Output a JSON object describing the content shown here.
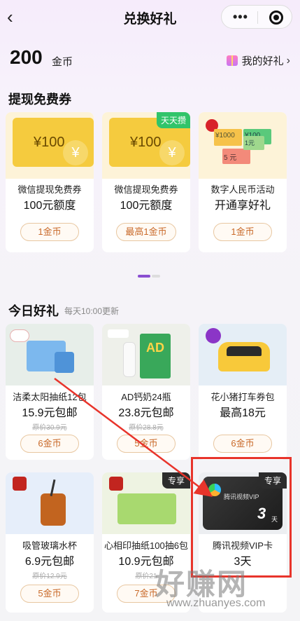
{
  "nav": {
    "title": "兑换好礼"
  },
  "header": {
    "coins": "200",
    "coins_unit": "金币",
    "my_gifts": "我的好礼"
  },
  "section1": {
    "title": "提现免费券",
    "cards": [
      {
        "voucher_amount": "¥100",
        "name": "微信提现免费券",
        "value": "100元额度",
        "price": "1金币"
      },
      {
        "voucher_amount": "¥100",
        "badge": "天天攒",
        "name": "微信提现免费券",
        "value": "100元额度",
        "price": "最高1金币"
      },
      {
        "name": "数字人民币活动",
        "value": "开通享好礼",
        "price": "1金币",
        "notes": [
          "¥1000",
          "¥100",
          "5 元",
          "1元"
        ]
      }
    ]
  },
  "section2": {
    "title": "今日好礼",
    "subtitle": "每天10:00更新",
    "cards": [
      {
        "name": "洁柔太阳抽纸12包",
        "price_text": "15.9元包邮",
        "original": "原价30.9元",
        "price": "6金币"
      },
      {
        "name": "AD钙奶24瓶",
        "price_text": "23.8元包邮",
        "original": "原价28.8元",
        "price": "5金币",
        "product_text": "AD"
      },
      {
        "name": "花小猪打车券包",
        "price_text": "最高18元",
        "price": "6金币"
      },
      {
        "name": "吸管玻璃水杯",
        "price_text": "6.9元包邮",
        "original": "原价12.9元",
        "price": "5金币"
      },
      {
        "name": "心相印抽纸100抽6包",
        "badge": "专享",
        "price_text": "10.9元包邮",
        "original": "原价21",
        "price": "7金币"
      },
      {
        "name": "腾讯视频VIP卡",
        "badge": "专享",
        "price_text": "3天",
        "card_brand": "腾讯视频VIP",
        "card_days": "3",
        "card_unit": "天"
      }
    ]
  },
  "watermark": {
    "text": "好赚网",
    "url": "www.zhuanyes.com"
  },
  "colors": {
    "accent": "#8a4ed1",
    "coin_orange": "#c96a2a",
    "annotation_red": "#e8342b"
  }
}
